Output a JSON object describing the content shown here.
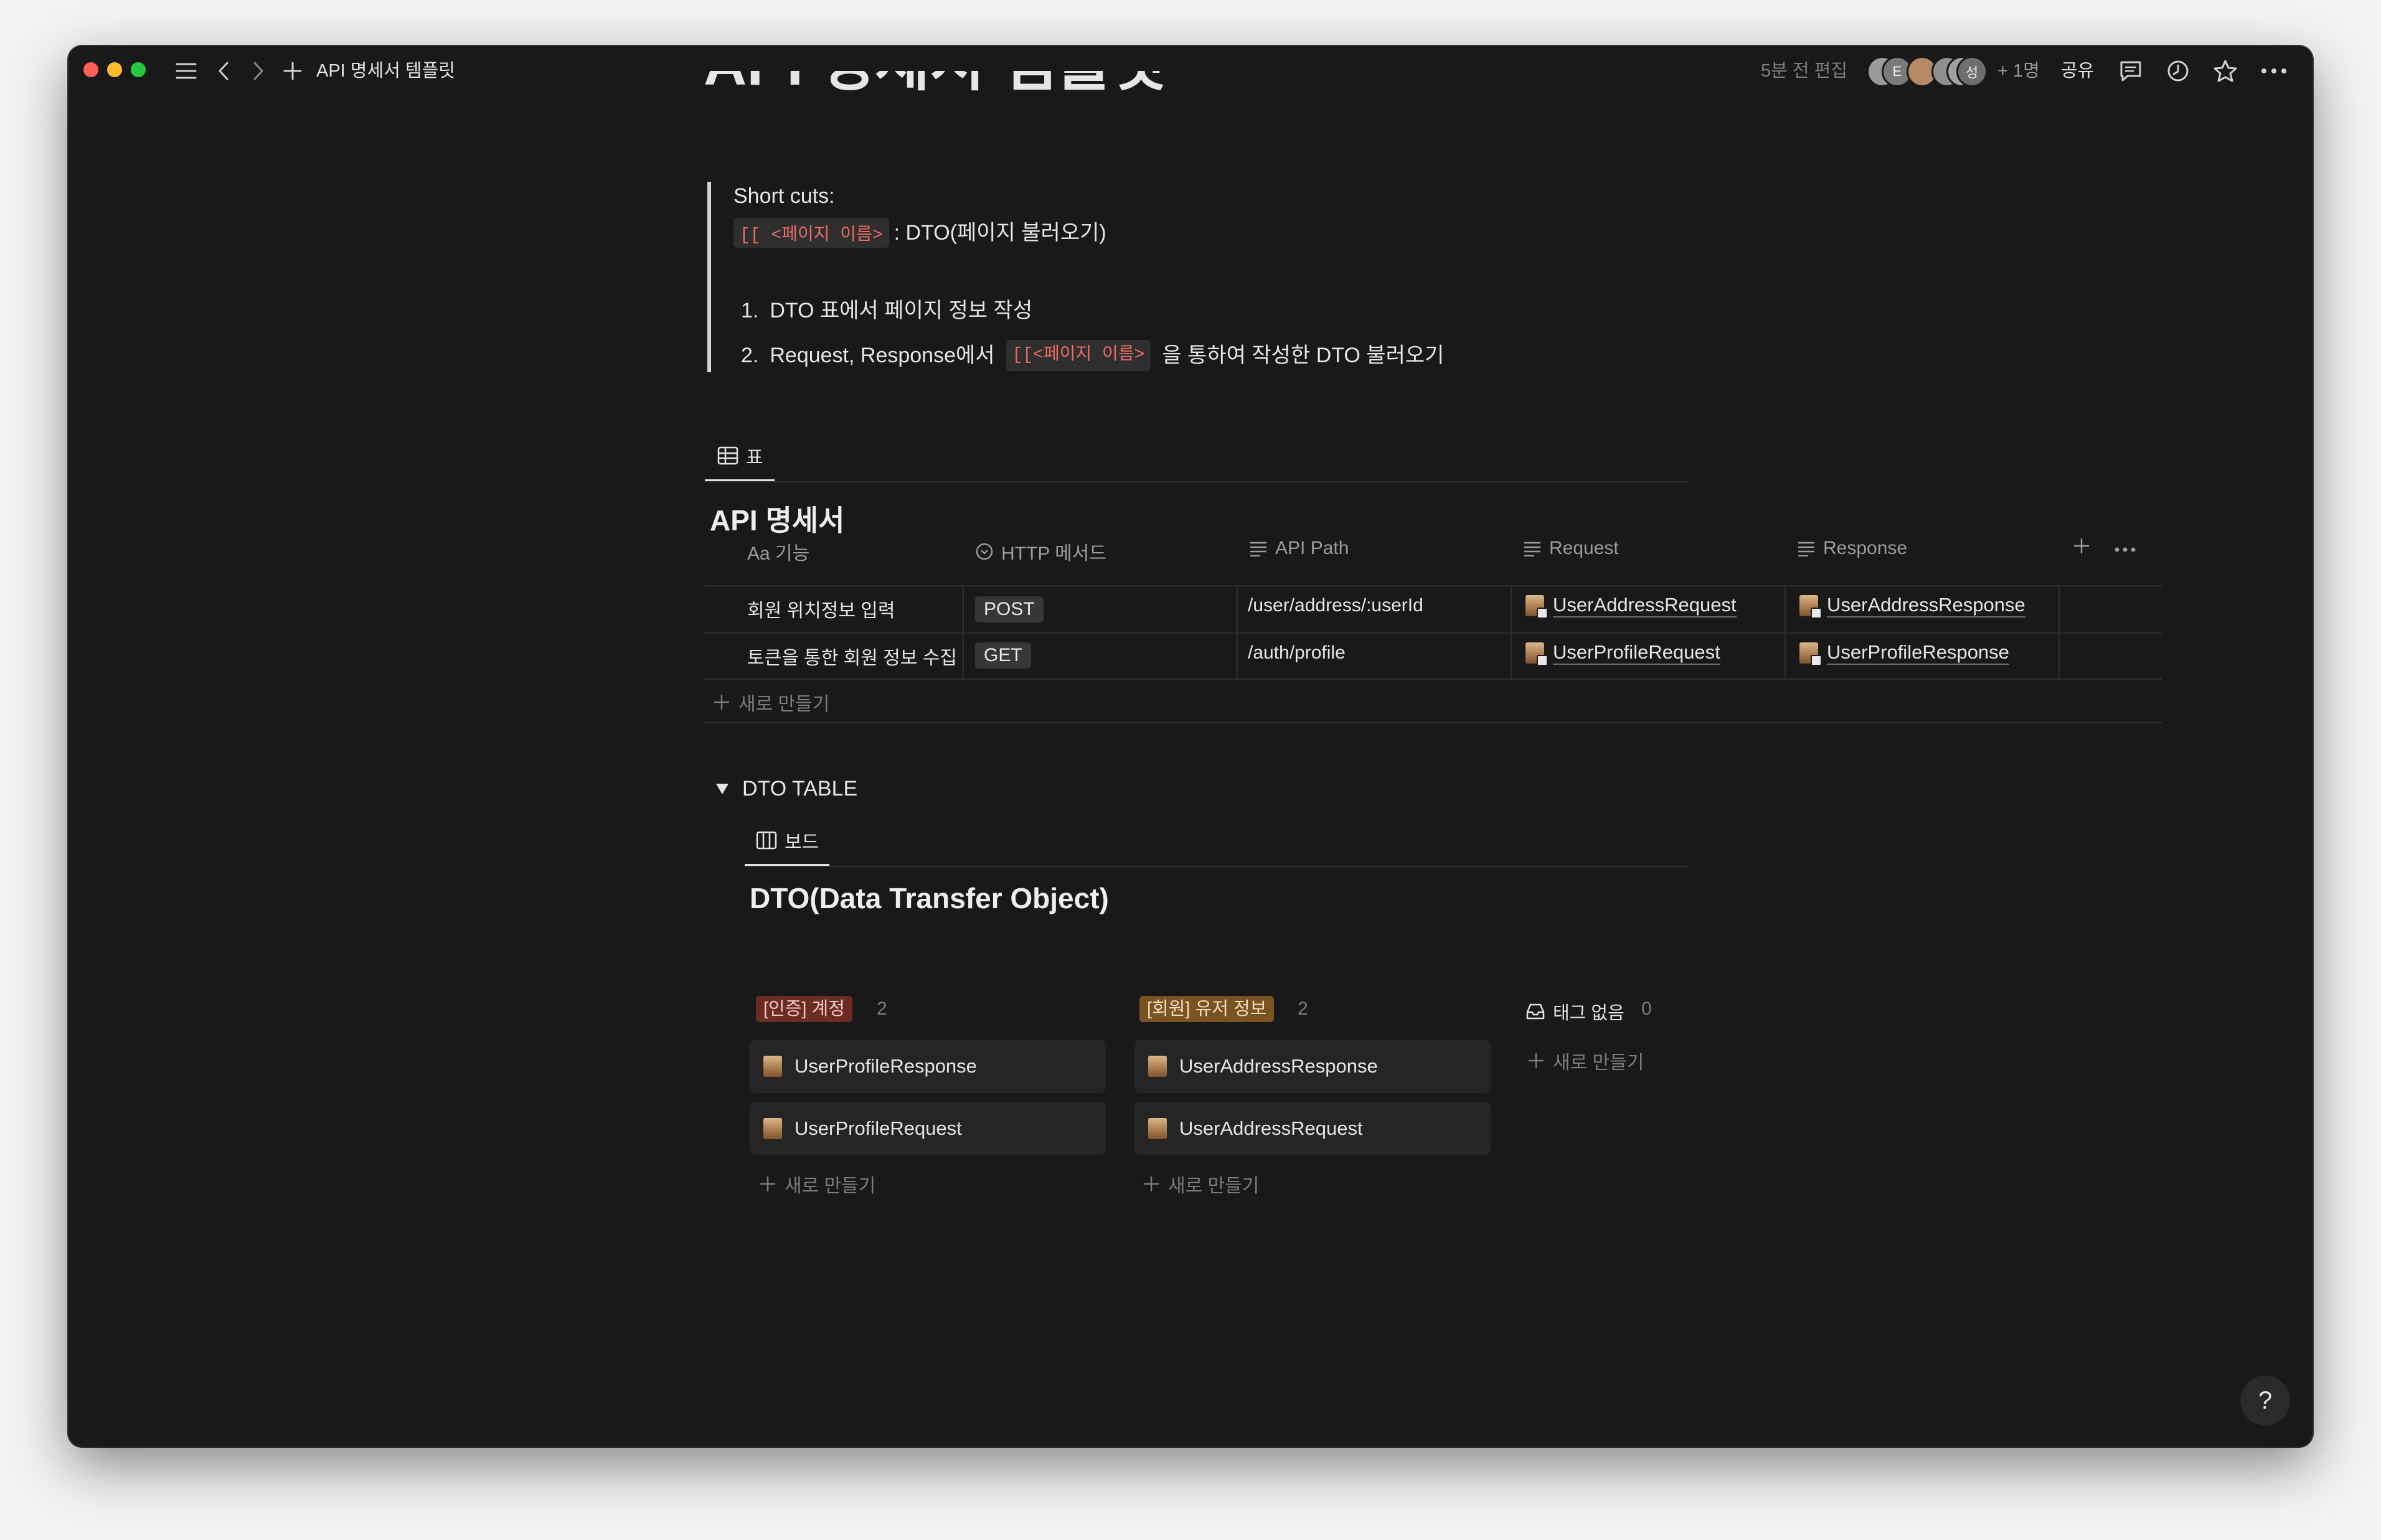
{
  "topbar": {
    "nav_title": "API 명세서 템플릿",
    "edited": "5분 전 편집",
    "avatars": [
      {
        "initial": "",
        "color": "#9a9a9a"
      },
      {
        "initial": "E",
        "color": "#7a7a7a"
      },
      {
        "initial": "",
        "color": "#b78a66"
      },
      {
        "initial": "",
        "color": "#8f8f8f"
      },
      {
        "initial": "",
        "color": "#a0a0a0"
      },
      {
        "initial": "성",
        "color": "#6e6e6e"
      }
    ],
    "more_people": "+ 1명",
    "share": "공유"
  },
  "callout": {
    "heading": "Short cuts:",
    "code_1": "[[ <페이지 이름>",
    "line_1_rest": ": DTO(페이지 불러오기)",
    "list": [
      {
        "num": "1.",
        "text": "DTO 표에서 페이지 정보 작성"
      },
      {
        "num": "2.",
        "text_before": "Request, Response에서",
        "code": "[[<페이지 이름>",
        "text_after": "을 통하여 작성한 DTO 불러오기"
      }
    ]
  },
  "api_view": {
    "tab_label": "표",
    "title": "API 명세서",
    "columns": [
      "Aa 기능",
      "HTTP 메서드",
      "API Path",
      "Request",
      "Response"
    ],
    "rows": [
      {
        "name": "회원 위치정보 입력",
        "method": "POST",
        "path": "/user/address/:userId",
        "request": "UserAddressRequest",
        "response": "UserAddressResponse"
      },
      {
        "name": "토큰을 통한 회원 정보 수집",
        "method": "GET",
        "path": "/auth/profile",
        "request": "UserProfileRequest",
        "response": "UserProfileResponse"
      }
    ],
    "new_label": "새로 만들기"
  },
  "dto": {
    "toggle_label": "DTO TABLE",
    "tab_label": "보드",
    "title": "DTO(Data Transfer Object)",
    "groups": [
      {
        "label": "[인증] 계정",
        "count": "2",
        "color": "#6b2c24",
        "text_color": "#f0c9c2",
        "cards": [
          "UserProfileResponse",
          "UserProfileRequest"
        ],
        "new_label": "새로 만들기"
      },
      {
        "label": "[회원] 유저 정보",
        "count": "2",
        "color": "#7a5322",
        "text_color": "#f3dcc0",
        "cards": [
          "UserAddressResponse",
          "UserAddressRequest"
        ],
        "new_label": "새로 만들기"
      },
      {
        "label": "태그 없음",
        "count": "0",
        "cards": [],
        "new_label": "새로 만들기"
      }
    ]
  },
  "help": "?"
}
